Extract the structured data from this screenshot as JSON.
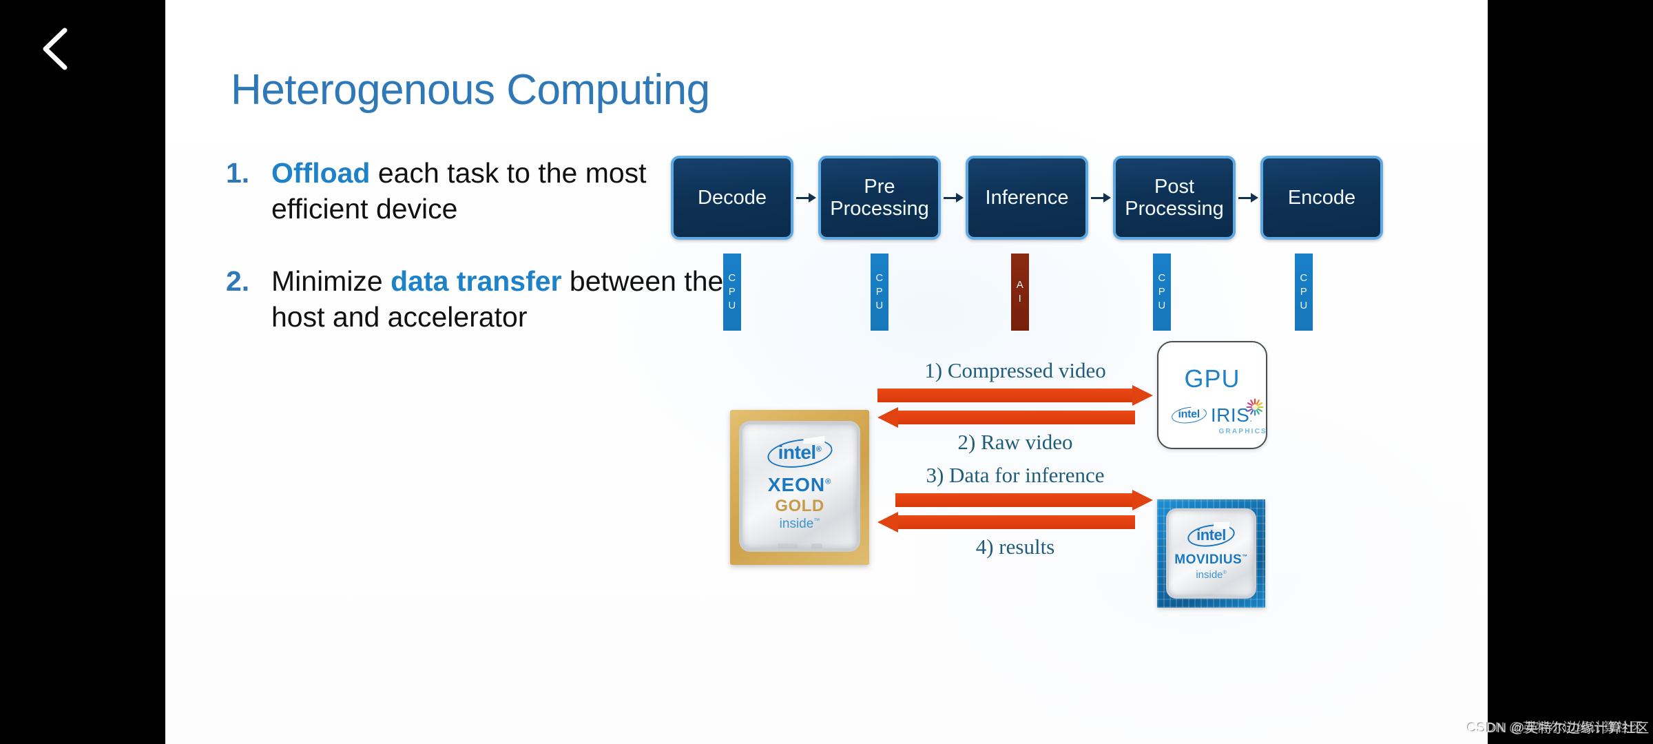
{
  "viewer": {
    "back_icon": "chevron-left-icon"
  },
  "slide": {
    "title": "Heterogenous Computing",
    "bullets": [
      {
        "number": "1.",
        "pre": "",
        "highlight": "Offload",
        "post": " each task to the most efficient device"
      },
      {
        "number": "2.",
        "pre": "Minimize ",
        "highlight": "data transfer",
        "post": " between the host and accelerator"
      }
    ],
    "pipeline": {
      "arrow_icon": "arrow-right-icon",
      "stages": [
        {
          "label": "Decode",
          "device": "CPU",
          "device_kind": "cpu"
        },
        {
          "label": "Pre Processing",
          "device": "CPU",
          "device_kind": "cpu"
        },
        {
          "label": "Inference",
          "device": "AI",
          "device_kind": "ai"
        },
        {
          "label": "Post Processing",
          "device": "CPU",
          "device_kind": "cpu"
        },
        {
          "label": "Encode",
          "device": "CPU",
          "device_kind": "cpu"
        }
      ]
    },
    "hardware": {
      "xeon": {
        "brand": "intel",
        "registered": "®",
        "name": "XEON",
        "name_mark": "®",
        "grade": "GOLD",
        "inside": "inside",
        "inside_mark": "™"
      },
      "gpu": {
        "title": "GPU",
        "brand": "intel",
        "product": "IRIS",
        "product_mark": ".",
        "subtitle": "GRAPHICS",
        "starburst_icon": "starburst-icon"
      },
      "movidius": {
        "brand": "intel",
        "name": "MOVIDIUS",
        "name_mark": "™",
        "inside": "inside",
        "inside_mark": "®"
      },
      "flows": [
        {
          "id": "flow-gpu",
          "top_label": "1) Compressed video",
          "bottom_label": "2) Raw video"
        },
        {
          "id": "flow-movidius",
          "top_label": "3) Data for inference",
          "bottom_label": "4) results"
        }
      ]
    }
  },
  "watermark": {
    "text": "CSDN @英特尔边缘计算社区"
  },
  "colors": {
    "title_blue": "#2e78b8",
    "highlight_blue": "#1d82c8",
    "box_fill": "#0e3256",
    "box_border": "#5ea9e2",
    "cpu_tag": "#1980c8",
    "ai_tag": "#8a2a12",
    "arrow_orange": "#e04210",
    "flow_label": "#1f5d7a"
  }
}
